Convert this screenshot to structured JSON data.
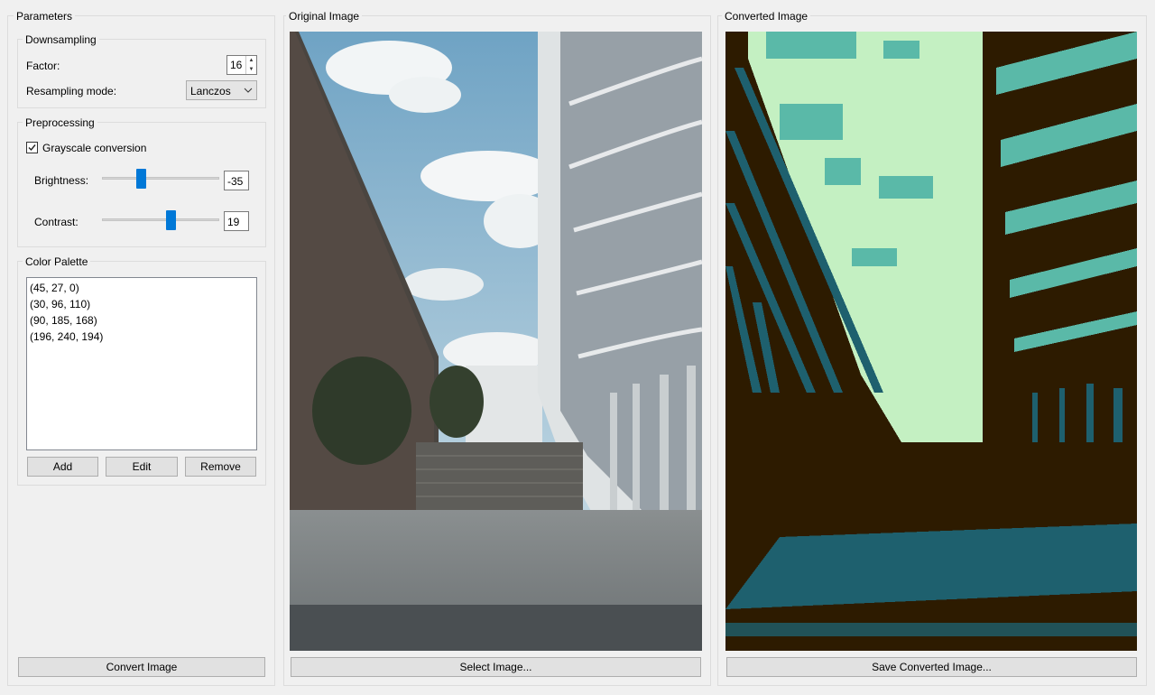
{
  "parameters": {
    "title": "Parameters",
    "downsampling": {
      "title": "Downsampling",
      "factor_label": "Factor:",
      "factor_value": "16",
      "mode_label": "Resampling mode:",
      "mode_value": "Lanczos"
    },
    "preprocessing": {
      "title": "Preprocessing",
      "grayscale_label": "Grayscale conversion",
      "grayscale_checked": true,
      "brightness_label": "Brightness:",
      "brightness_value": "-35",
      "brightness_level": -35,
      "contrast_label": "Contrast:",
      "contrast_value": "19",
      "contrast_level": 19
    },
    "palette": {
      "title": "Color Palette",
      "colors": [
        "(45, 27, 0)",
        "(30, 96, 110)",
        "(90, 185, 168)",
        "(196, 240, 194)"
      ],
      "add_label": "Add",
      "edit_label": "Edit",
      "remove_label": "Remove"
    },
    "convert_label": "Convert Image"
  },
  "original": {
    "title": "Original Image",
    "select_label": "Select Image..."
  },
  "converted": {
    "title": "Converted Image",
    "save_label": "Save Converted Image...",
    "palette_colors": [
      "#2d1b00",
      "#1e606e",
      "#5ab9a8",
      "#c4f0c2"
    ]
  }
}
